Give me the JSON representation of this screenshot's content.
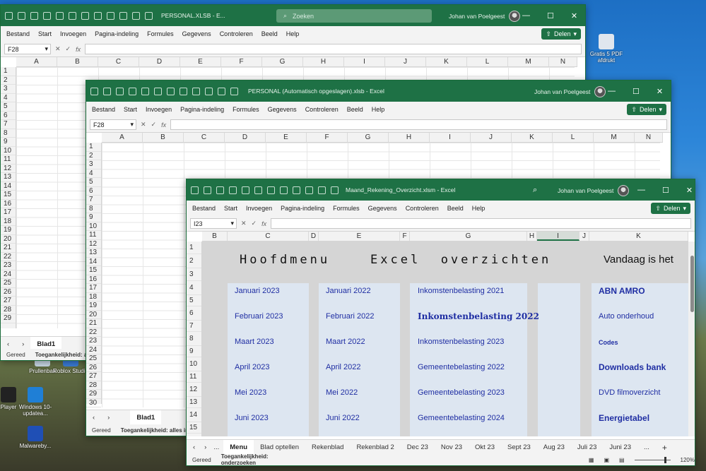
{
  "desktop": {
    "icons": [
      {
        "label": "Prullenbak",
        "color": "#c9d8e6"
      },
      {
        "label": "Roblox Studio",
        "color": "#3a7bd5"
      },
      {
        "label": "Windows 10-updatea...",
        "color": "#1f7fd6"
      },
      {
        "label": "Malwareby...",
        "color": "#1f4fb5"
      },
      {
        "label": "Player",
        "color": "#222"
      },
      {
        "label": "Gratis 5 PDF afdrukt",
        "color": "#e0e6ee"
      }
    ]
  },
  "window_back": {
    "title": "PERSONAL.XLSB - E...",
    "search_placeholder": "Zoeken",
    "user": "Johan van Poelgeest",
    "menus": [
      "Bestand",
      "Start",
      "Invoegen",
      "Pagina-indeling",
      "Formules",
      "Gegevens",
      "Controleren",
      "Beeld",
      "Help"
    ],
    "share_label": "Delen",
    "namebox": "F28",
    "columns": [
      "A",
      "B",
      "C",
      "D",
      "E",
      "F",
      "G",
      "H",
      "I",
      "J",
      "K",
      "L",
      "M",
      "N"
    ],
    "rows": [
      "1",
      "2",
      "3",
      "4",
      "5",
      "6",
      "7",
      "8",
      "9",
      "10",
      "11",
      "12",
      "13",
      "14",
      "15",
      "16",
      "17",
      "18",
      "19",
      "20",
      "21",
      "22",
      "23",
      "24",
      "25",
      "26",
      "27",
      "28",
      "29",
      "30"
    ],
    "sheet_tab": "Blad1",
    "status": [
      "Gereed",
      "Toegankelijkheid: a"
    ]
  },
  "window_middle": {
    "title": "PERSONAL (Automatisch opgeslagen).xlsb - Excel",
    "user": "Johan van Poelgeest",
    "menus": [
      "Bestand",
      "Start",
      "Invoegen",
      "Pagina-indeling",
      "Formules",
      "Gegevens",
      "Controleren",
      "Beeld",
      "Help"
    ],
    "share_label": "Delen",
    "namebox": "F28",
    "columns": [
      "A",
      "B",
      "C",
      "D",
      "E",
      "F",
      "G",
      "H",
      "I",
      "J",
      "K",
      "L",
      "M",
      "N"
    ],
    "rows": [
      "1",
      "2",
      "3",
      "4",
      "5",
      "6",
      "7",
      "8",
      "9",
      "10",
      "11",
      "12",
      "13",
      "14",
      "15",
      "16",
      "17",
      "18",
      "19",
      "20",
      "21",
      "22",
      "23",
      "24",
      "25",
      "26",
      "27",
      "28",
      "29",
      "30"
    ],
    "sheet_tab": "Blad1",
    "status": [
      "Gereed",
      "Toegankelijkheid: alles in"
    ]
  },
  "window_front": {
    "title": "Maand_Rekening_Overzicht.xlsm - Excel",
    "user": "Johan van Poelgeest",
    "menus": [
      "Bestand",
      "Start",
      "Invoegen",
      "Pagina-indeling",
      "Formules",
      "Gegevens",
      "Controleren",
      "Beeld",
      "Help"
    ],
    "share_label": "Delen",
    "namebox": "I23",
    "columns": [
      "B",
      "C",
      "D",
      "E",
      "F",
      "G",
      "H",
      "I",
      "J",
      "K"
    ],
    "rows": [
      "1",
      "2",
      "3",
      "4",
      "5",
      "6",
      "7",
      "8",
      "9",
      "10",
      "11",
      "12",
      "13",
      "14",
      "15"
    ],
    "heading": "Hoofdmenu    Excel  overzichten",
    "vandaag": "Vandaag is het",
    "col_c": [
      "Januari 2023",
      "Februari 2023",
      "Maart 2023",
      "April 2023",
      "Mei 2023",
      "Juni 2023"
    ],
    "col_e": [
      "Januari 2022",
      "Februari 2022",
      "Maart 2022",
      "April 2022",
      "Mei 2022",
      "Juni 2022"
    ],
    "col_g": [
      "Inkomstenbelasting 2021",
      "Inkomstenbelasting 2022",
      "Inkomstenbelasting 2023",
      "Gemeentebelasting 2022",
      "Gemeentebelasting 2023",
      "Gemeentebelasting 2024"
    ],
    "col_k": [
      "ABN AMRO",
      "Auto onderhoud",
      "Codes",
      "Downloads bank",
      "DVD filmoverzicht",
      "Energietabel"
    ],
    "tabs": [
      "Menu",
      "Blad optellen",
      "Rekenblad",
      "Rekenblad 2",
      "Dec 23",
      "Nov 23",
      "Okt 23",
      "Sept 23",
      "Aug 23",
      "Juli 23",
      "Juni 23"
    ],
    "tabs_more": "...",
    "status": [
      "Gereed",
      "Toegankelijkheid: onderzoeken"
    ],
    "zoom": "120%"
  }
}
